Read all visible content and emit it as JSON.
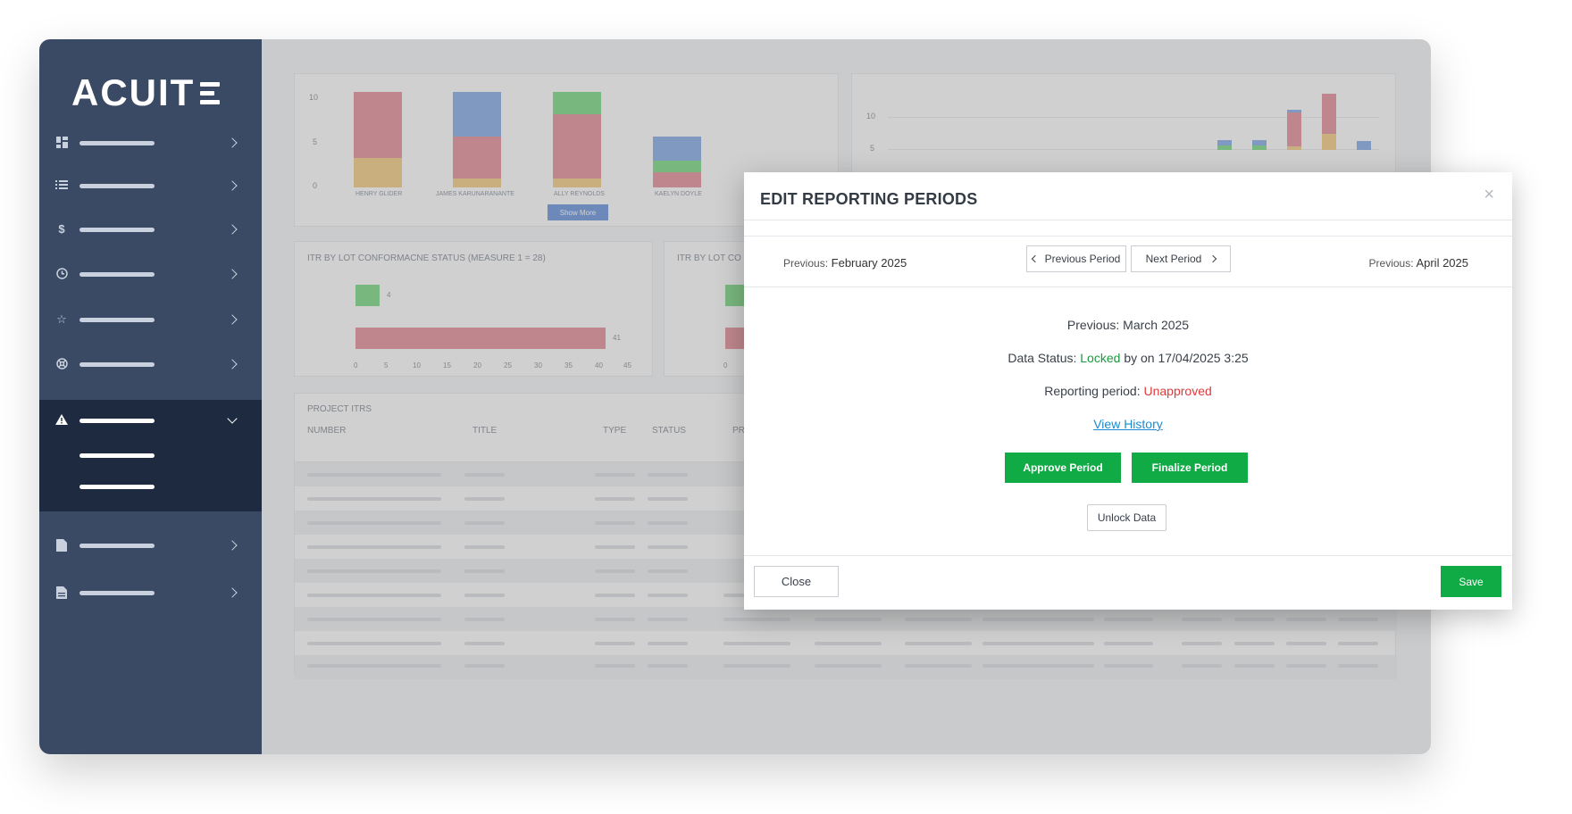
{
  "brand": {
    "logo_text": "ACUIT"
  },
  "colors": {
    "sidebar": "#3a4964",
    "sidebar_active": "#1e2a3f",
    "green": "#11ab46",
    "red": "#e03a3a",
    "link": "#1a8ccf"
  },
  "sidebar": {
    "icons": [
      "dashboard-icon",
      "list-icon",
      "dollar-icon",
      "clock-icon",
      "star-icon",
      "globe-icon",
      "warning-icon",
      "document-icon",
      "file-icon"
    ]
  },
  "dashboard": {
    "chart1": {
      "y_ticks": [
        "10",
        "5",
        "0"
      ],
      "categories": [
        "HENRY GLIDER",
        "JAMES KARUNARANANTE",
        "ALLY REYNOLDS",
        "KAELYN DOYLE"
      ],
      "show_more": "Show More"
    },
    "chart2": {
      "y_ticks": [
        "10",
        "5"
      ]
    },
    "chart3": {
      "title": "ITR BY LOT CONFORMACNE STATUS (MEASURE 1 = 28)",
      "values": [
        "4",
        "41"
      ],
      "x_ticks": [
        "0",
        "5",
        "10",
        "15",
        "20",
        "25",
        "30",
        "35",
        "40",
        "45"
      ]
    },
    "chart4": {
      "title": "ITR BY LOT CO",
      "x_ticks": [
        "0"
      ]
    },
    "table": {
      "title": "PROJECT ITRS",
      "columns": [
        "NUMBER",
        "TITLE",
        "TYPE",
        "STATUS",
        "PR"
      ]
    }
  },
  "modal": {
    "title": "EDIT REPORTING PERIODS",
    "close_glyph": "×",
    "prev_period": {
      "label": "Previous:",
      "value": "February 2025"
    },
    "next_period": {
      "label": "Previous:",
      "value": "April 2025"
    },
    "prev_button": "Previous Period",
    "next_button": "Next Period",
    "current": {
      "label": "Previous:",
      "value": "March 2025"
    },
    "data_status": {
      "label": "Data Status:",
      "status": "Locked",
      "suffix": "by on 17/04/2025 3:25"
    },
    "reporting_period": {
      "label": "Reporting period:",
      "status": "Unapproved"
    },
    "view_history": "View History",
    "approve_button": "Approve Period",
    "finalize_button": "Finalize Period",
    "unlock_button": "Unlock Data",
    "close_button": "Close",
    "save_button": "Save"
  }
}
